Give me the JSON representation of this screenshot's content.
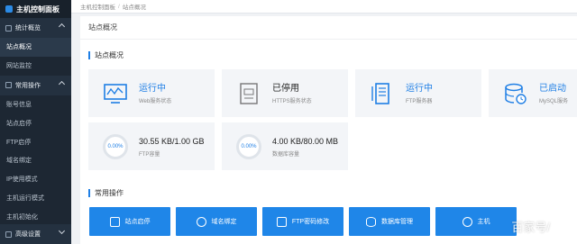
{
  "sidebar": {
    "title": "主机控制面板",
    "groups": [
      {
        "label": "统计概览",
        "expanded": true
      },
      {
        "label": "常用操作",
        "expanded": true
      },
      {
        "label": "高级设置",
        "expanded": false
      }
    ],
    "stats_items": [
      "站点概况",
      "网站监控"
    ],
    "ops_items": [
      "账号信息",
      "站点启停",
      "FTP启停",
      "域名绑定",
      "IP使用模式",
      "主机运行模式",
      "主机初始化"
    ]
  },
  "breadcrumb": {
    "root": "主机控制面板",
    "separator": "/",
    "current": "站点概况"
  },
  "page": {
    "title": "站点概况"
  },
  "overview": {
    "section_title": "站点概况",
    "cards": [
      {
        "icon": "web-monitor-icon",
        "value": "运行中",
        "label": "Web服务状态",
        "color": "#1f7fe5"
      },
      {
        "icon": "ssl-certificate-icon",
        "value": "已停用",
        "label": "HTTPS服务状态",
        "color": "#222222"
      },
      {
        "icon": "ftp-server-icon",
        "value": "运行中",
        "label": "FTP服务器",
        "color": "#1f7fe5"
      },
      {
        "icon": "mysql-database-icon",
        "value": "已启动",
        "label": "MySQL服务",
        "color": "#1f7fe5"
      }
    ],
    "usage": [
      {
        "percent": "0.00%",
        "value": "30.55 KB/1.00 GB",
        "label": "FTP容量"
      },
      {
        "percent": "0.00%",
        "value": "4.00 KB/80.00 MB",
        "label": "数据库容量"
      }
    ]
  },
  "ops": {
    "section_title": "常用操作",
    "buttons": [
      {
        "label": "站点启停",
        "icon": "monitor-icon"
      },
      {
        "label": "域名绑定",
        "icon": "globe-icon"
      },
      {
        "label": "FTP密码修改",
        "icon": "lock-icon"
      },
      {
        "label": "数据库管理",
        "icon": "database-icon"
      },
      {
        "label": "主机",
        "icon": "play-icon"
      }
    ]
  },
  "watermark": "百家号/"
}
